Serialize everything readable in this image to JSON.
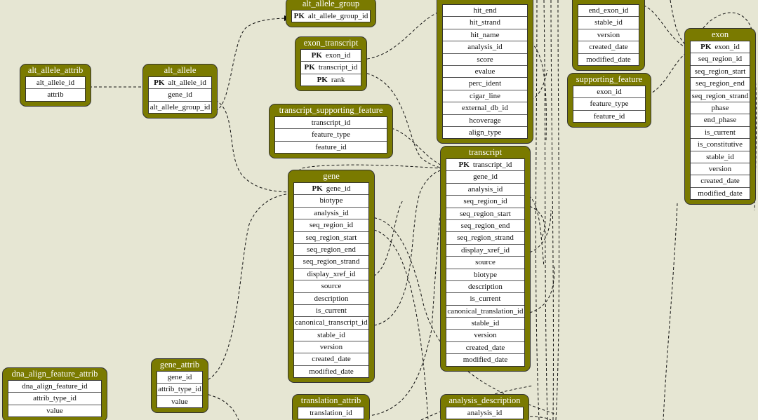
{
  "tables": [
    {
      "name": "alt_allele_attrib",
      "columns": [
        {
          "label": "alt_allele_id"
        },
        {
          "label": "attrib"
        }
      ]
    },
    {
      "name": "alt_allele",
      "columns": [
        {
          "pk": "PK",
          "label": "alt_allele_id"
        },
        {
          "label": "gene_id"
        },
        {
          "label": "alt_allele_group_id"
        }
      ]
    },
    {
      "name": "alt_allele_group",
      "columns": [
        {
          "pk": "PK",
          "label": "alt_allele_group_id"
        }
      ]
    },
    {
      "name": "exon_transcript",
      "columns": [
        {
          "pk": "PK",
          "label": "exon_id"
        },
        {
          "pk": "PK",
          "label": "transcript_id"
        },
        {
          "pk": "PK",
          "label": "rank"
        }
      ]
    },
    {
      "name": "transcript_supporting_feature",
      "columns": [
        {
          "label": "transcript_id"
        },
        {
          "label": "feature_type"
        },
        {
          "label": "feature_id"
        }
      ]
    },
    {
      "name": "gene",
      "columns": [
        {
          "pk": "PK",
          "label": "gene_id"
        },
        {
          "label": "biotype"
        },
        {
          "label": "analysis_id"
        },
        {
          "label": "seq_region_id"
        },
        {
          "label": "seq_region_start"
        },
        {
          "label": "seq_region_end"
        },
        {
          "label": "seq_region_strand"
        },
        {
          "label": "display_xref_id"
        },
        {
          "label": "source"
        },
        {
          "label": "description"
        },
        {
          "label": "is_current"
        },
        {
          "label": "canonical_transcript_id"
        },
        {
          "label": "stable_id"
        },
        {
          "label": "version"
        },
        {
          "label": "created_date"
        },
        {
          "label": "modified_date"
        }
      ]
    },
    {
      "name": "",
      "columns": [
        {
          "label": "hit_end"
        },
        {
          "label": "hit_strand"
        },
        {
          "label": "hit_name"
        },
        {
          "label": "analysis_id"
        },
        {
          "label": "score"
        },
        {
          "label": "evalue"
        },
        {
          "label": "perc_ident"
        },
        {
          "label": "cigar_line"
        },
        {
          "label": "external_db_id"
        },
        {
          "label": "hcoverage"
        },
        {
          "label": "align_type"
        }
      ]
    },
    {
      "name": "transcript",
      "columns": [
        {
          "pk": "PK",
          "label": "transcript_id"
        },
        {
          "label": "gene_id"
        },
        {
          "label": "analysis_id"
        },
        {
          "label": "seq_region_id"
        },
        {
          "label": "seq_region_start"
        },
        {
          "label": "seq_region_end"
        },
        {
          "label": "seq_region_strand"
        },
        {
          "label": "display_xref_id"
        },
        {
          "label": "source"
        },
        {
          "label": "biotype"
        },
        {
          "label": "description"
        },
        {
          "label": "is_current"
        },
        {
          "label": "canonical_translation_id"
        },
        {
          "label": "stable_id"
        },
        {
          "label": "version"
        },
        {
          "label": "created_date"
        },
        {
          "label": "modified_date"
        }
      ]
    },
    {
      "name": "",
      "columns": [
        {
          "label": "end_exon_id"
        },
        {
          "label": "stable_id"
        },
        {
          "label": "version"
        },
        {
          "label": "created_date"
        },
        {
          "label": "modified_date"
        }
      ]
    },
    {
      "name": "supporting_feature",
      "columns": [
        {
          "label": "exon_id"
        },
        {
          "label": "feature_type"
        },
        {
          "label": "feature_id"
        }
      ]
    },
    {
      "name": "exon",
      "columns": [
        {
          "pk": "PK",
          "label": "exon_id"
        },
        {
          "label": "seq_region_id"
        },
        {
          "label": "seq_region_start"
        },
        {
          "label": "seq_region_end"
        },
        {
          "label": "seq_region_strand"
        },
        {
          "label": "phase"
        },
        {
          "label": "end_phase"
        },
        {
          "label": "is_current"
        },
        {
          "label": "is_constitutive"
        },
        {
          "label": "stable_id"
        },
        {
          "label": "version"
        },
        {
          "label": "created_date"
        },
        {
          "label": "modified_date"
        }
      ]
    },
    {
      "name": "gene_attrib",
      "columns": [
        {
          "label": "gene_id"
        },
        {
          "label": "attrib_type_id"
        },
        {
          "label": "value"
        }
      ]
    },
    {
      "name": "dna_align_feature_attrib",
      "columns": [
        {
          "label": "dna_align_feature_id"
        },
        {
          "label": "attrib_type_id"
        },
        {
          "label": "value"
        }
      ]
    },
    {
      "name": "translation_attrib",
      "columns": [
        {
          "label": "translation_id"
        }
      ]
    },
    {
      "name": "analysis_description",
      "columns": [
        {
          "label": "analysis_id"
        }
      ]
    }
  ],
  "colors": {
    "table_fill": "#7a7a00",
    "background": "#e6e6d3",
    "edge": "#111111"
  }
}
